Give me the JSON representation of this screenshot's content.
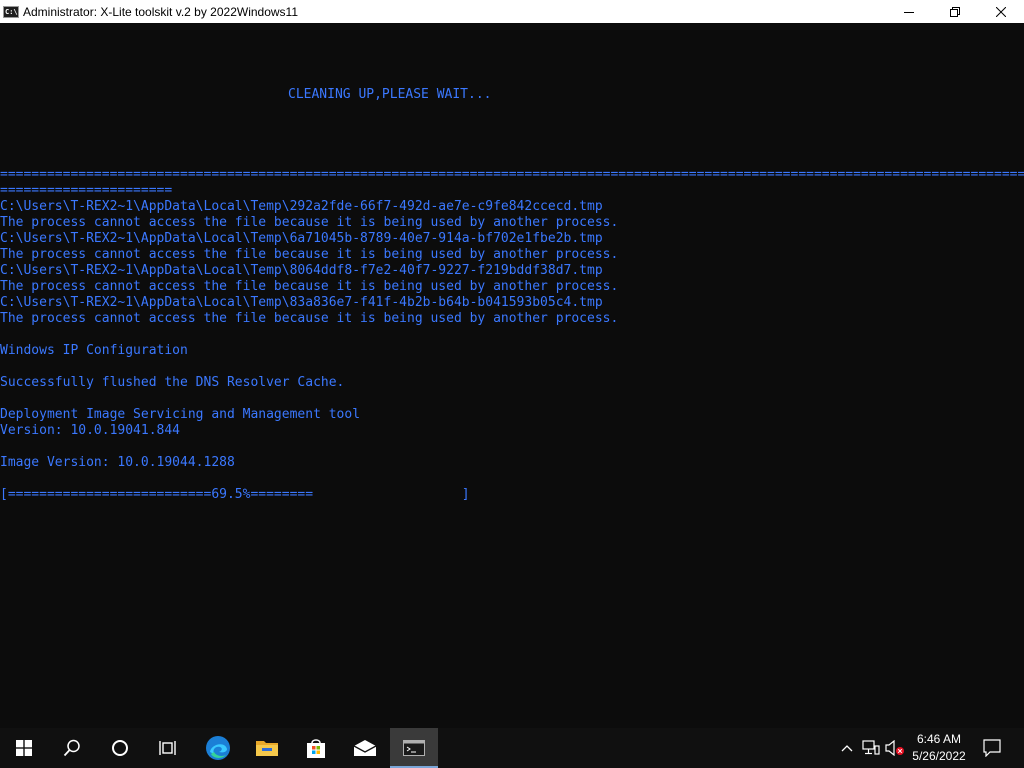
{
  "window": {
    "title": "Administrator:  X-Lite toolskit v.2 by 2022Windows11",
    "icon": "console-icon",
    "icon_glyph": "C:\\"
  },
  "console": {
    "text_color": "#3b78ff",
    "background": "#0c0c0c",
    "status": "CLEANING UP,PLEASE WAIT...",
    "separator_1": "======================================================================================================================================",
    "separator_2": "======================",
    "output": [
      "C:\\Users\\T-REX2~1\\AppData\\Local\\Temp\\292a2fde-66f7-492d-ae7e-c9fe842ccecd.tmp",
      "The process cannot access the file because it is being used by another process.",
      "C:\\Users\\T-REX2~1\\AppData\\Local\\Temp\\6a71045b-8789-40e7-914a-bf702e1fbe2b.tmp",
      "The process cannot access the file because it is being used by another process.",
      "C:\\Users\\T-REX2~1\\AppData\\Local\\Temp\\8064ddf8-f7e2-40f7-9227-f219bddf38d7.tmp",
      "The process cannot access the file because it is being used by another process.",
      "C:\\Users\\T-REX2~1\\AppData\\Local\\Temp\\83a836e7-f41f-4b2b-b64b-b041593b05c4.tmp",
      "The process cannot access the file because it is being used by another process."
    ],
    "ip_config": "Windows IP Configuration",
    "dns_flush": "Successfully flushed the DNS Resolver Cache.",
    "dism_title": "Deployment Image Servicing and Management tool",
    "dism_version": "Version: 10.0.19041.844",
    "image_version": "Image Version: 10.0.19044.1288",
    "progress_text": "[==========================69.5%========                   ]",
    "progress_percent": 69.5
  },
  "taskbar": {
    "items": [
      {
        "name": "start-button",
        "icon": "windows-logo-icon"
      },
      {
        "name": "search-button",
        "icon": "search-icon"
      },
      {
        "name": "cortana-button",
        "icon": "cortana-circle-icon"
      },
      {
        "name": "task-view-button",
        "icon": "task-view-icon"
      },
      {
        "name": "edge-button",
        "icon": "edge-icon"
      },
      {
        "name": "file-explorer-button",
        "icon": "folder-icon"
      },
      {
        "name": "store-button",
        "icon": "store-bag-icon"
      },
      {
        "name": "mail-button",
        "icon": "mail-icon"
      },
      {
        "name": "console-taskbar-button",
        "icon": "console-icon",
        "active": true
      }
    ],
    "tray_icons": [
      "chevron-up-icon",
      "network-icon",
      "volume-muted-icon"
    ],
    "time": "6:46 AM",
    "date": "5/26/2022",
    "notification_icon": "notification-icon"
  },
  "colors": {
    "console_text": "#3b78ff",
    "taskbar_bg": "#101010",
    "active_underline": "#7aa6d8"
  }
}
